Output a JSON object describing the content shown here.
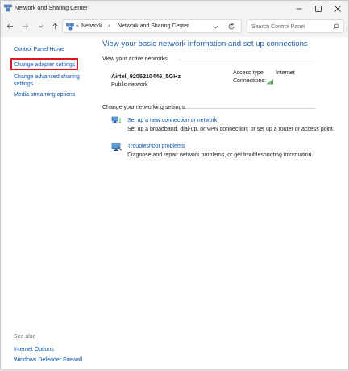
{
  "window": {
    "title": "Network and Sharing Center"
  },
  "address": {
    "crumb_overflow": "«",
    "crumb_1": "Network ...",
    "separator": "›",
    "crumb_2": "Network and Sharing Center"
  },
  "search": {
    "placeholder": "Search Control Panel"
  },
  "left_panel": {
    "home": "Control Panel Home",
    "adapter": "Change adapter settings",
    "advanced": "Change advanced sharing settings",
    "media": "Media streaming options"
  },
  "see_also": {
    "heading": "See also",
    "internet_options": "Internet Options",
    "firewall": "Windows Defender Firewall"
  },
  "main": {
    "title": "View your basic network information and set up connections",
    "active_heading": "View your active networks",
    "network_name": "Airtel_9205210446_5GHz",
    "network_type": "Public network",
    "access_type_label": "Access type:",
    "access_type_value": "Internet",
    "connections_label": "Connections:",
    "change_heading": "Change your networking settings",
    "task_setup_link": "Set up a new connection or network",
    "task_setup_desc": "Set up a broadband, dial-up, or VPN connection; or set up a router or access point.",
    "task_trouble_link": "Troubleshoot problems",
    "task_trouble_desc": "Diagnose and repair network problems, or get troubleshooting information."
  },
  "colors": {
    "link": "#0a56b0",
    "title": "#1a5aa6",
    "highlight": "#e0161c",
    "wifi_signal": "#3a9a3a"
  },
  "icons": [
    "network-center-icon",
    "minimize-icon",
    "maximize-icon",
    "close-icon",
    "back-arrow-icon",
    "forward-arrow-icon",
    "recent-dropdown-icon",
    "up-arrow-icon",
    "refresh-icon",
    "search-icon",
    "wifi-signal-icon",
    "new-connection-icon",
    "troubleshoot-icon"
  ]
}
